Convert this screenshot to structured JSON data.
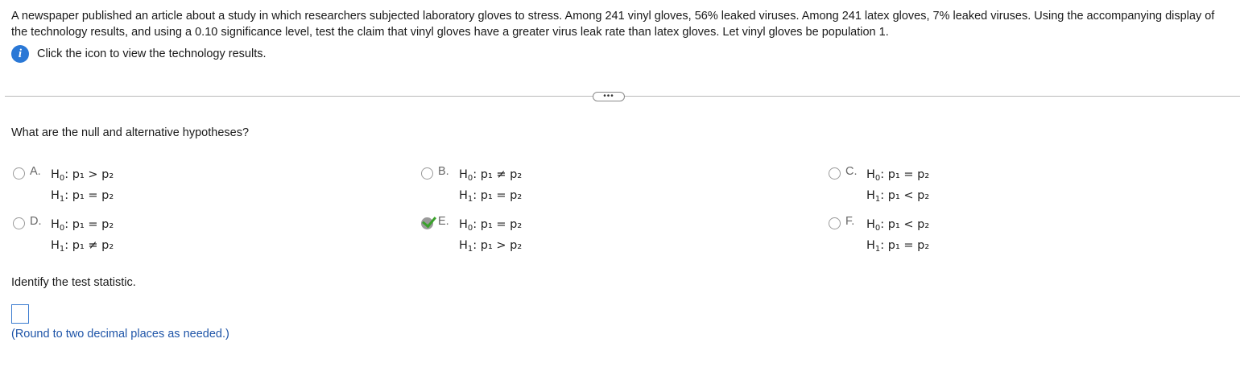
{
  "problem": {
    "text": "A newspaper published an article about a study in which researchers subjected laboratory gloves to stress. Among 241 vinyl gloves, 56% leaked viruses. Among 241 latex gloves, 7% leaked viruses. Using the accompanying display of the technology results, and using a 0.10 significance level, test the claim that vinyl gloves have a greater virus leak rate than latex gloves. Let vinyl gloves be population 1.",
    "info_link": "Click the icon to view the technology results.",
    "info_icon": "info-icon",
    "more_label": "•••"
  },
  "question1": {
    "prompt": "What are the null and alternative hypotheses?",
    "options": [
      {
        "letter": "A.",
        "h0_label": "H",
        "h0_sub": "0",
        "h0_rel": ": p₁ > p₂",
        "h1_label": "H",
        "h1_sub": "1",
        "h1_rel": ": p₁ = p₂",
        "selected": false
      },
      {
        "letter": "B.",
        "h0_label": "H",
        "h0_sub": "0",
        "h0_rel": ": p₁ ≠ p₂",
        "h1_label": "H",
        "h1_sub": "1",
        "h1_rel": ": p₁ = p₂",
        "selected": false
      },
      {
        "letter": "C.",
        "h0_label": "H",
        "h0_sub": "0",
        "h0_rel": ": p₁ = p₂",
        "h1_label": "H",
        "h1_sub": "1",
        "h1_rel": ": p₁ < p₂",
        "selected": false
      },
      {
        "letter": "D.",
        "h0_label": "H",
        "h0_sub": "0",
        "h0_rel": ": p₁ = p₂",
        "h1_label": "H",
        "h1_sub": "1",
        "h1_rel": ": p₁ ≠ p₂",
        "selected": false
      },
      {
        "letter": "E.",
        "h0_label": "H",
        "h0_sub": "0",
        "h0_rel": ": p₁ = p₂",
        "h1_label": "H",
        "h1_sub": "1",
        "h1_rel": ": p₁ > p₂",
        "selected": true
      },
      {
        "letter": "F.",
        "h0_label": "H",
        "h0_sub": "0",
        "h0_rel": ": p₁ < p₂",
        "h1_label": "H",
        "h1_sub": "1",
        "h1_rel": ": p₁ = p₂",
        "selected": false
      }
    ]
  },
  "question2": {
    "prompt": "Identify the test statistic.",
    "answer_value": "",
    "hint": "(Round to two decimal places as needed.)"
  },
  "colors": {
    "info_icon": "#2a78d6",
    "check": "#3aa12b",
    "hint": "#1f55a8",
    "input_border": "#3a7bd0"
  }
}
